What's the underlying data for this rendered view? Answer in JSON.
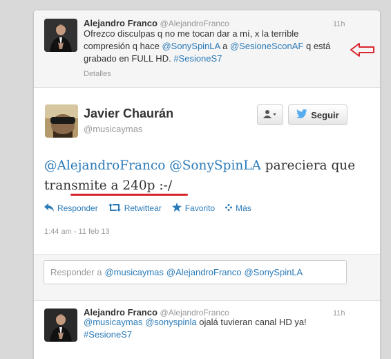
{
  "tweet1": {
    "name": "Alejandro Franco",
    "handle": "@AlejandroFranco",
    "time": "11h",
    "text_part1": "Ofrezco disculpas q no me tocan dar a mí, x la terrible compresión q hace ",
    "mention1": "@SonySpinLA",
    "text_part2": " a ",
    "mention2": "@SesioneSconAF",
    "text_part3": " q está grabado en FULL HD. ",
    "hashtag": "#SesioneS7",
    "details": "Detalles"
  },
  "main_tweet": {
    "name": "Javier Chaurán",
    "handle": "@musicaymas",
    "follow_label": "Seguir",
    "mention1": "@AlejandroFranco",
    "mention2": "@SonySpinLA",
    "text": " pareciera que transmite a 240p :-/",
    "actions": {
      "reply": "Responder",
      "retweet": "Retwittear",
      "favorite": "Favorito",
      "more": "Más"
    },
    "timestamp": "1:44 am - 11 feb 13"
  },
  "reply_box": {
    "prefix": "Responder a",
    "mention1": "@musicaymas",
    "mention2": "@AlejandroFranco",
    "mention3": "@SonySpinLA"
  },
  "tweet3": {
    "name": "Alejandro Franco",
    "handle": "@AlejandroFranco",
    "time": "11h",
    "mention1": "@musicaymas",
    "mention2": "@sonyspinla",
    "text": " ojalá tuvieran canal HD ya!",
    "hashtag": "#SesioneS7"
  },
  "colors": {
    "link": "#2b7bb9",
    "annotation_red": "#d8262e"
  }
}
